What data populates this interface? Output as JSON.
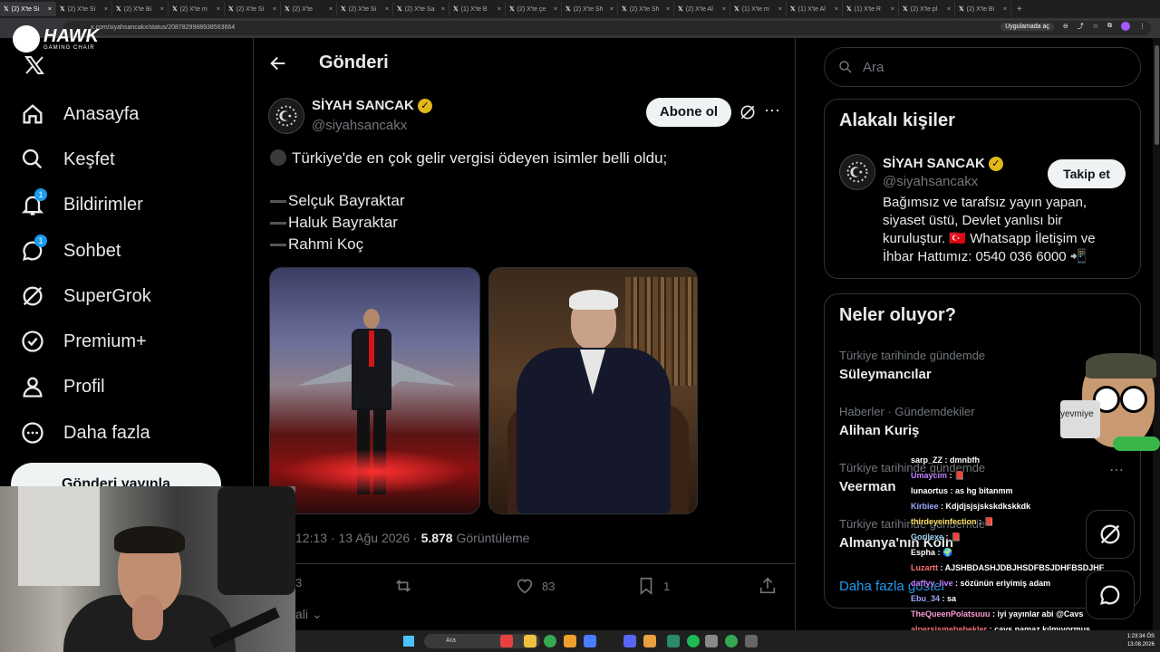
{
  "browser": {
    "tabs": [
      "(2) X'te Si",
      "(2) X'te Si",
      "(2) X'te Bi",
      "(2) X'te m",
      "(2) X'te Si",
      "(2) X'te",
      "(2) X'te Si",
      "(2) X'te Sa",
      "(1) X'te B",
      "(2) X'te çe",
      "(2) X'te Sh",
      "(2) X'te Sh",
      "(2) X'te Al",
      "(1) X'te m",
      "(1) X'te Al",
      "(1) X'te R",
      "(2) X'te pl",
      "(2) X'te Bi"
    ],
    "url": "x.com/siyahsancakx/status/2087829988938563664",
    "open_in_app": "Uygulamada aç"
  },
  "logos": {
    "hawk": "HAWK",
    "hawk_sub": "GAMING CHAIR"
  },
  "nav": {
    "items": [
      {
        "label": "Anasayfa",
        "icon": "home-icon"
      },
      {
        "label": "Keşfet",
        "icon": "search-icon"
      },
      {
        "label": "Bildirimler",
        "icon": "bell-icon",
        "badge": "1"
      },
      {
        "label": "Sohbet",
        "icon": "chat-icon",
        "badge": "1"
      },
      {
        "label": "SuperGrok",
        "icon": "grok-icon"
      },
      {
        "label": "Premium+",
        "icon": "verified-icon"
      },
      {
        "label": "Profil",
        "icon": "person-icon"
      },
      {
        "label": "Daha fazla",
        "icon": "more-circle-icon"
      }
    ],
    "post_button": "Gönderi yayınla"
  },
  "main": {
    "title": "Gönderi",
    "author": {
      "name": "SİYAH SANCAK",
      "handle": "@siyahsancakx"
    },
    "subscribe": "Abone ol",
    "text_line1": "Türkiye'de en çok gelir vergisi ödeyen isimler belli oldu;",
    "names": [
      "Selçuk Bayraktar",
      "Haluk Bayraktar",
      "Rahmi Koç"
    ],
    "time": "12:13 · 13 Ağu 2026 · ",
    "views": "5.878",
    "views_label": "Görüntüleme",
    "actions": {
      "replies": "3",
      "likes": "83",
      "bookmarks": "1"
    },
    "reply_partial": "ali"
  },
  "right": {
    "search_placeholder": "Ara",
    "related_title": "Alakalı kişiler",
    "related": {
      "name": "SİYAH SANCAK",
      "handle": "@siyahsancakx",
      "follow": "Takip et",
      "bio": "Bağımsız ve tarafsız yayın yapan, siyaset üstü, Devlet yanlısı bir kuruluştur. 🇹🇷 Whatsapp İletişim ve İhbar Hattımız: 0540 036 6000 📲"
    },
    "whats_title": "Neler oluyor?",
    "trends": [
      {
        "meta": "Türkiye tarihinde gündemde",
        "name": "Süleymancılar"
      },
      {
        "meta": "Haberler · Gündemdekiler",
        "name": "Alihan Kuriş"
      },
      {
        "meta": "Türkiye tarihinde gündemde",
        "name": "Veerman"
      },
      {
        "meta": "Türkiye tarihinde gündemde",
        "name": "Almanya'nın Koln"
      }
    ],
    "show_more": "Daha fazla göster"
  },
  "overlay": {
    "sticker_label": "yevmiye",
    "chat": [
      {
        "user": "sarp_ZZ",
        "msg": ": dmnbfh",
        "color": "#ffffff"
      },
      {
        "user": "Umaycim",
        "msg": ": 📕",
        "color": "#c080ff"
      },
      {
        "user": "lunaortus",
        "msg": ": as hg bitanmm",
        "color": "#ffffff"
      },
      {
        "user": "Kirbiee",
        "msg": ": Kdjdjsjsjskskdkskkdk",
        "color": "#9fa8ff"
      },
      {
        "user": "thirdeyeinfection",
        "msg": ": 📕",
        "color": "#ffe066"
      },
      {
        "user": "Gorilexe",
        "msg": ": 📕",
        "color": "#9fd8ff"
      },
      {
        "user": "Espha",
        "msg": ": 🌍",
        "color": "#ffffff"
      },
      {
        "user": "Luzartt",
        "msg": ": AJSHBDASHJDBJHSDFBSJDHFBSDJHF",
        "color": "#ff7070"
      },
      {
        "user": "daffyy_live",
        "msg": ": sözünün eriyimiş adam",
        "color": "#c080ff"
      },
      {
        "user": "Ebu_34",
        "msg": ": sa",
        "color": "#9fa8ff"
      },
      {
        "user": "TheQueenPolatsuuu",
        "msg": ": iyi yayınlar abi @Cavs",
        "color": "#ff9ad5"
      },
      {
        "user": "alpersismebebekler",
        "msg": ": cavs namaz kılmıyormuş",
        "color": "#ff7070"
      }
    ]
  },
  "taskbar": {
    "search": "Ara",
    "time": "1:23:34 ÖS",
    "date": "13.08.2026"
  }
}
